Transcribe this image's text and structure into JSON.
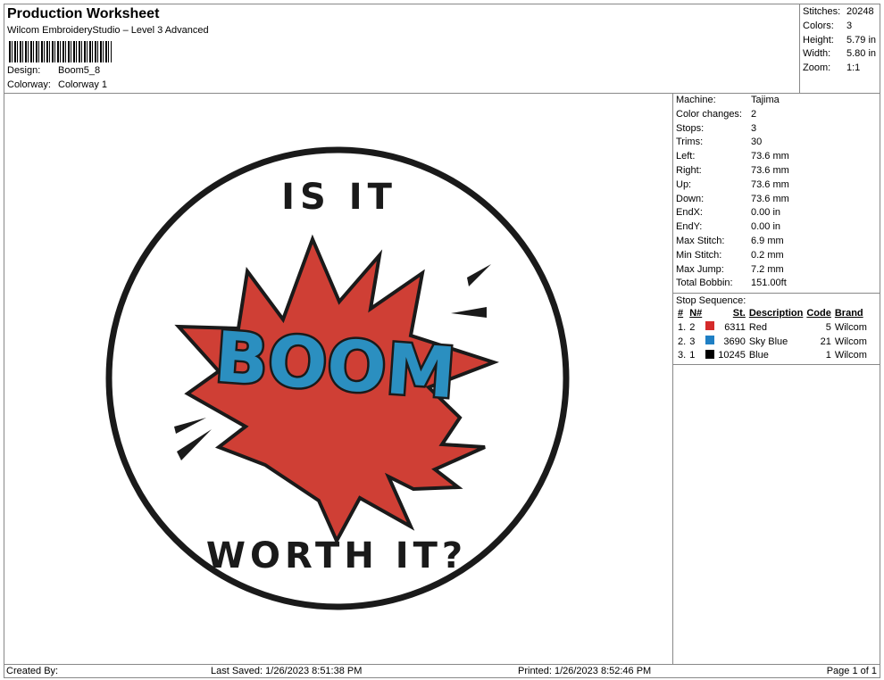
{
  "header": {
    "title": "Production Worksheet",
    "subtitle": "Wilcom EmbroideryStudio – Level 3 Advanced",
    "design_label": "Design:",
    "design_value": "Boom5_8",
    "colorway_label": "Colorway:",
    "colorway_value": "Colorway 1"
  },
  "summary": [
    {
      "label": "Stitches:",
      "value": "20248"
    },
    {
      "label": "Colors:",
      "value": "3"
    },
    {
      "label": "Height:",
      "value": "5.79 in"
    },
    {
      "label": "Width:",
      "value": "5.80 in"
    },
    {
      "label": "Zoom:",
      "value": "1:1"
    }
  ],
  "machine_info": [
    {
      "label": "Machine:",
      "value": "Tajima"
    },
    {
      "label": "Color changes:",
      "value": "2"
    },
    {
      "label": "Stops:",
      "value": "3"
    },
    {
      "label": "Trims:",
      "value": "30"
    },
    {
      "label": "Left:",
      "value": "73.6 mm"
    },
    {
      "label": "Right:",
      "value": "73.6 mm"
    },
    {
      "label": "Up:",
      "value": "73.6 mm"
    },
    {
      "label": "Down:",
      "value": "73.6 mm"
    },
    {
      "label": "EndX:",
      "value": "0.00 in"
    },
    {
      "label": "EndY:",
      "value": "0.00 in"
    },
    {
      "label": "Max Stitch:",
      "value": "6.9 mm"
    },
    {
      "label": "Min Stitch:",
      "value": "0.2 mm"
    },
    {
      "label": "Max Jump:",
      "value": "7.2 mm"
    },
    {
      "label": "Total Bobbin:",
      "value": "151.00ft"
    }
  ],
  "stop_sequence": {
    "title": "Stop Sequence:",
    "headers": [
      "#",
      "N#",
      "St.",
      "Description",
      "Code",
      "Brand"
    ],
    "rows": [
      {
        "num": "1.",
        "n": "2",
        "color": "#d42a2a",
        "st": "6311",
        "desc": "Red",
        "code": "5",
        "brand": "Wilcom"
      },
      {
        "num": "2.",
        "n": "3",
        "color": "#1f7fc4",
        "st": "3690",
        "desc": "Sky Blue",
        "code": "21",
        "brand": "Wilcom"
      },
      {
        "num": "3.",
        "n": "1",
        "color": "#000000",
        "st": "10245",
        "desc": "Blue",
        "code": "1",
        "brand": "Wilcom"
      }
    ]
  },
  "design": {
    "top_text": "IS IT",
    "center_text": "BOOM",
    "bottom_text": "WORTH IT?",
    "colors": {
      "red": "#cf3f35",
      "blue": "#2b8fc0",
      "outline": "#1a1a1a"
    }
  },
  "footer": {
    "created_by": "Created By:",
    "last_saved": "Last Saved: 1/26/2023 8:51:38 PM",
    "printed": "Printed: 1/26/2023 8:52:46 PM",
    "page": "Page 1 of 1"
  }
}
